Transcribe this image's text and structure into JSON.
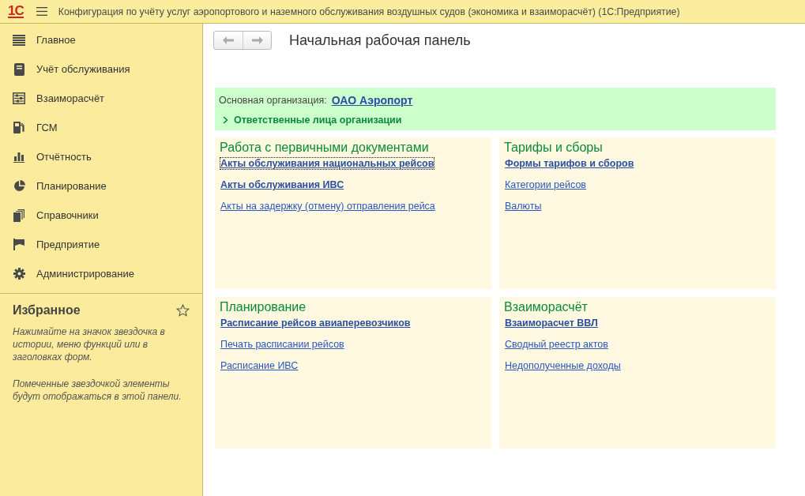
{
  "window": {
    "logo": "1С",
    "title": "Конфигурация по учёту услуг аэропортового и наземного обслуживания воздушных судов (экономика и взаиморасчёт)  (1С:Предприятие)"
  },
  "sidebar": {
    "items": [
      {
        "label": "Главное"
      },
      {
        "label": "Учёт обслуживания"
      },
      {
        "label": "Взаиморасчёт"
      },
      {
        "label": "ГСМ"
      },
      {
        "label": "Отчётность"
      },
      {
        "label": "Планирование"
      },
      {
        "label": "Справочники"
      },
      {
        "label": "Предприятие"
      },
      {
        "label": "Администрирование"
      }
    ],
    "favorites": {
      "title": "Избранное",
      "hints": [
        "Нажимайте на значок звездочка в истории, меню функций или в заголовках форм.",
        "Помеченные звездочкой элементы будут отображаться в этой панели."
      ]
    }
  },
  "page": {
    "title": "Начальная рабочая панель",
    "organization": {
      "label": "Основная организация:",
      "value": "ОАО Аэропорт",
      "group": {
        "label": "Ответственные лица организации",
        "expanded": false
      }
    },
    "sections": [
      {
        "title": "Работа с первичными документами",
        "links": [
          {
            "label": "Акты обслуживания национальных рейсов",
            "bold": true,
            "focused": true
          },
          {
            "label": "Акты обслуживания ИВС",
            "bold": true,
            "focused": false
          },
          {
            "label": "Акты на задержку (отмену) отправления рейса",
            "bold": false,
            "focused": false
          }
        ]
      },
      {
        "title": "Тарифы и сборы",
        "links": [
          {
            "label": "Формы тарифов и сборов",
            "bold": true,
            "focused": false
          },
          {
            "label": "Категории рейсов",
            "bold": false,
            "focused": false
          },
          {
            "label": "Валюты",
            "bold": false,
            "focused": false
          }
        ]
      },
      {
        "title": "Планирование",
        "links": [
          {
            "label": "Расписание рейсов авиаперевозчиков",
            "bold": true,
            "focused": false
          },
          {
            "label": "Печать расписании рейсов",
            "bold": false,
            "focused": false
          },
          {
            "label": "Расписание ИВС",
            "bold": false,
            "focused": false
          }
        ]
      },
      {
        "title": "Взаиморасчёт",
        "links": [
          {
            "label": "Взаиморасчет ВВЛ",
            "bold": true,
            "focused": false
          },
          {
            "label": "Сводный реестр актов",
            "bold": false,
            "focused": false
          },
          {
            "label": "Недополученные доходы",
            "bold": false,
            "focused": false
          }
        ]
      }
    ]
  }
}
